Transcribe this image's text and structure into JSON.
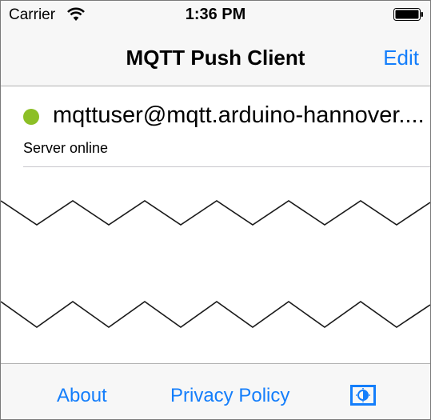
{
  "status_bar": {
    "carrier": "Carrier",
    "time": "1:36 PM",
    "icons": [
      "wifi-icon",
      "battery-icon"
    ]
  },
  "nav": {
    "title": "MQTT Push Client",
    "edit_label": "Edit"
  },
  "servers": [
    {
      "title": "mqttuser@mqtt.arduino-hannover....",
      "status": "Server online",
      "status_color": "#8cbf26"
    }
  ],
  "toolbar": {
    "about_label": "About",
    "privacy_label": "Privacy Policy",
    "settings_icon": "brightness-toggle-icon"
  },
  "colors": {
    "accent": "#147efb",
    "bar_background": "#f7f7f7",
    "online": "#8cbf26"
  }
}
